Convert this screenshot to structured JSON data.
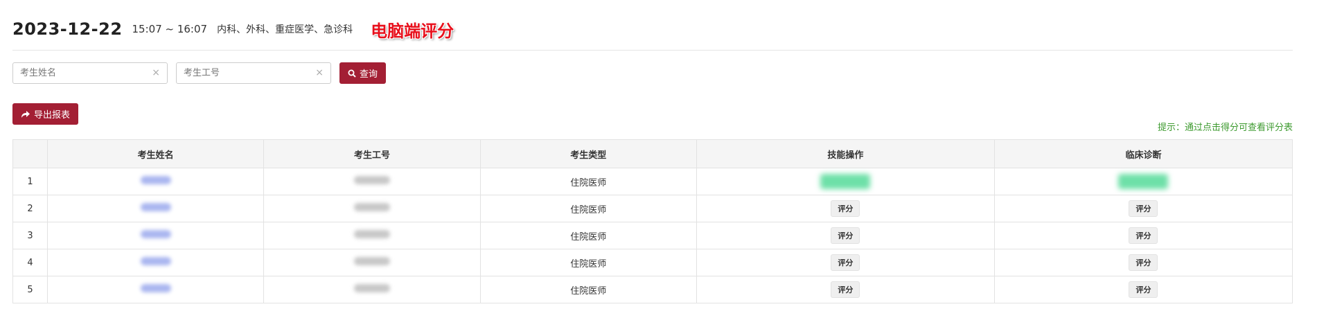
{
  "header": {
    "date": "2023-12-22",
    "time": "15:07 ~ 16:07",
    "departments": "内科、外科、重症医学、急诊科",
    "banner": "电脑端评分"
  },
  "search": {
    "name_placeholder": "考生姓名",
    "id_placeholder": "考生工号",
    "clear_icon": "×",
    "query_label": "查询"
  },
  "export": {
    "label": "导出报表"
  },
  "hint": "提示：通过点击得分可查看评分表",
  "table": {
    "columns": [
      "",
      "考生姓名",
      "考生工号",
      "考生类型",
      "技能操作",
      "临床诊断"
    ],
    "rows": [
      {
        "index": "1",
        "type": "住院医师",
        "skill": "",
        "diagnosis": ""
      },
      {
        "index": "2",
        "type": "住院医师",
        "skill": "评分",
        "diagnosis": "评分"
      },
      {
        "index": "3",
        "type": "住院医师",
        "skill": "评分",
        "diagnosis": "评分"
      },
      {
        "index": "4",
        "type": "住院医师",
        "skill": "评分",
        "diagnosis": "评分"
      },
      {
        "index": "5",
        "type": "住院医师",
        "skill": "评分",
        "diagnosis": "评分"
      }
    ]
  },
  "colors": {
    "primary": "#a31f34",
    "hint": "#3d9a2f",
    "banner": "#e8101c"
  }
}
